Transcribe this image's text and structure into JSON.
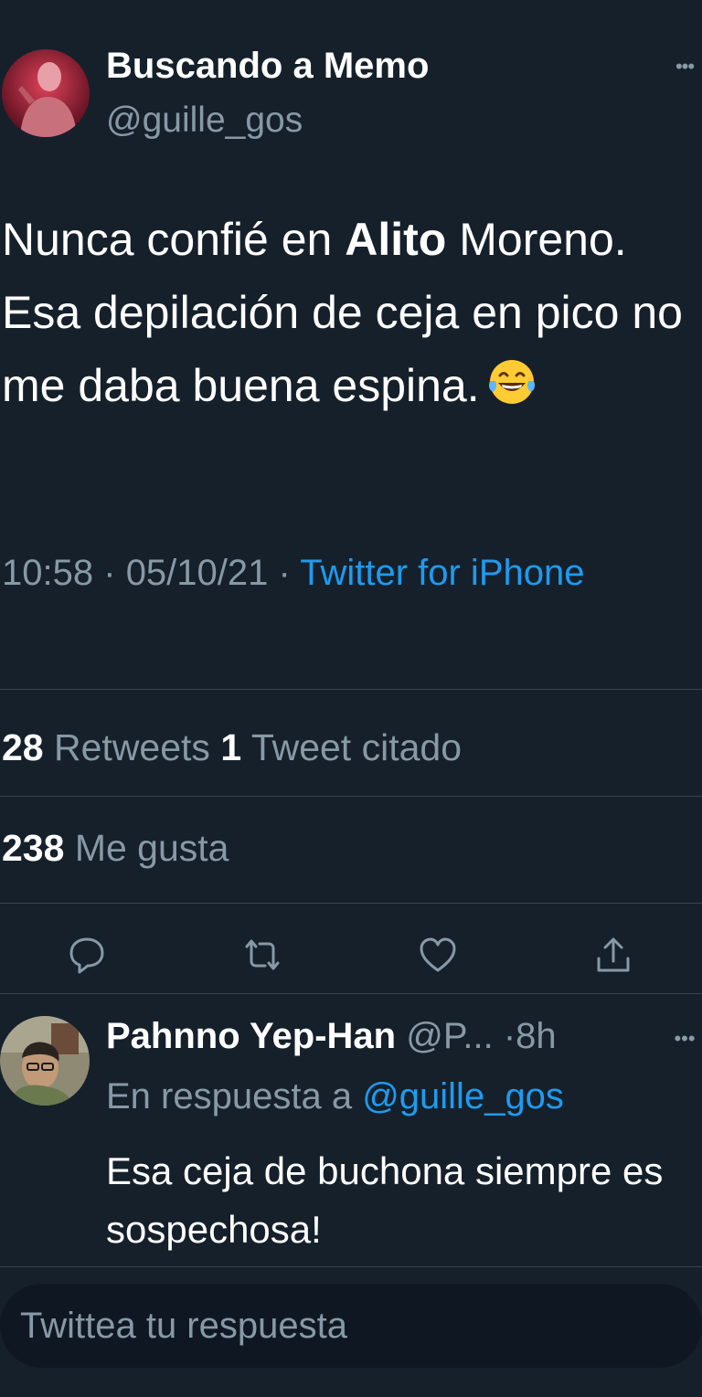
{
  "tweet": {
    "author_name": "Buscando a Memo",
    "author_handle": "@guille_gos",
    "text_before": "Nunca confié en ",
    "text_bold": "Alito",
    "text_after": " Moreno. Esa depilación de ceja en pico no me daba buena espina.",
    "emoji": "face-with-tears-of-joy",
    "time": "10:58",
    "date": "05/10/21",
    "separator": "·",
    "source": "Twitter for iPhone",
    "more_icon": "more-horizontal-icon"
  },
  "stats": {
    "retweets_count": "28",
    "retweets_label": "Retweets",
    "quotes_count": "1",
    "quotes_label": "Tweet citado",
    "likes_count": "238",
    "likes_label": "Me gusta"
  },
  "actions": {
    "icons": [
      "reply-icon",
      "retweet-icon",
      "like-icon",
      "share-icon"
    ]
  },
  "reply": {
    "author_name": "Pahnno Yep-Han",
    "author_handle": "@P...",
    "time": "·8h",
    "in_reply_prefix": "En respuesta a",
    "in_reply_mention": "@guille_gos",
    "text": "Esa ceja de buchona siempre es sospechosa!"
  },
  "compose": {
    "placeholder": "Twittea tu respuesta"
  },
  "colors": {
    "background": "#15202b",
    "text_primary": "#ffffff",
    "text_secondary": "#8899a6",
    "accent": "#1d9bf0",
    "divider": "#38444d"
  }
}
